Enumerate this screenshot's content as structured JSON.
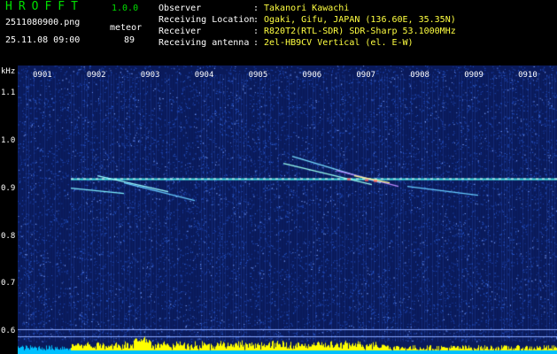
{
  "header": {
    "title": "HROFFT",
    "version": "1.0.0",
    "filename": "2511080900.png",
    "timestamp": "25.11.08 09:00",
    "mode": "meteor",
    "count": "89",
    "info": [
      {
        "label": "Observer",
        "value": "Takanori Kawachi"
      },
      {
        "label": "Receiving Location",
        "value": "Ogaki, Gifu, JAPAN (136.60E, 35.35N)"
      },
      {
        "label": "Receiver",
        "value": "R820T2(RTL-SDR) SDR-Sharp 53.1000MHz"
      },
      {
        "label": "Receiving antenna",
        "value": "2el-HB9CV Vertical (el. E-W)"
      }
    ],
    "colors": {
      "green": "#00e000",
      "white": "#ffffff",
      "yellow": "#ffff40"
    }
  },
  "chart_data": {
    "type": "heatmap",
    "ylabel": "kHz",
    "yticks": [
      "1.1",
      "1.0",
      "0.9",
      "0.8",
      "0.7",
      "0.6"
    ],
    "xticks": [
      "0901",
      "0902",
      "0903",
      "0904",
      "0905",
      "0906",
      "0907",
      "0908",
      "0909",
      "0910"
    ],
    "ylim": [
      0.58,
      1.16
    ],
    "xlim": [
      9.0,
      19.0
    ],
    "carrier_frequency": 0.921,
    "gap_minute": 7.2,
    "colors": {
      "background": "#0a1a5a",
      "noise": "#2a5cd0",
      "carrier": "#40e0e0",
      "amplitude": "#ffff00",
      "baseline": "#00c0ff"
    }
  }
}
